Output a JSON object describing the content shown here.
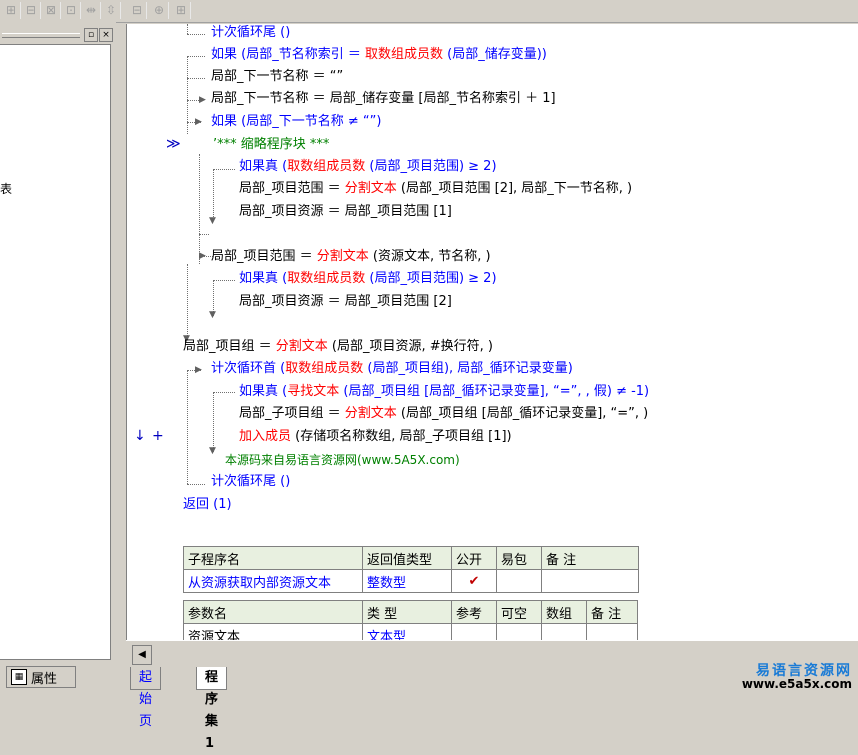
{
  "toolbar": {
    "buttons": [
      "⊞",
      "⊟",
      "⊠",
      "⊡",
      "⇹",
      "⇳",
      "⊟",
      "⊕",
      "⊞"
    ]
  },
  "left_panel": {
    "fragment": "表",
    "pin_symbol": "▫",
    "close_symbol": "×"
  },
  "properties_tab": {
    "label": "属性",
    "icon_glyph": "▦"
  },
  "gutter": {
    "marker": "≫",
    "arrow": "↓",
    "plus": "+"
  },
  "code": {
    "l1": "计次循环尾 ()",
    "l2a": "如果 (局部_节名称索引 ＝ ",
    "l2b": "取数组成员数",
    "l2c": " (局部_储存变量))",
    "l3": "局部_下一节名称 ＝ “”",
    "l4": "局部_下一节名称 ＝ 局部_储存变量 [局部_节名称索引 ＋ 1]",
    "l5": "如果 (局部_下一节名称 ≠ “”)",
    "l6": "’*** 缩略程序块 ***",
    "l7a": "如果真 (",
    "l7b": "取数组成员数",
    "l7c": " (局部_项目范围) ≥ 2)",
    "l8a": "局部_项目范围 ＝ ",
    "l8b": "分割文本",
    "l8c": " (局部_项目范围 [2], 局部_下一节名称, )",
    "l9": "局部_项目资源 ＝ 局部_项目范围 [1]",
    "l10a": "局部_项目范围 ＝ ",
    "l10b": "分割文本",
    "l10c": " (资源文本, 节名称, )",
    "l11a": "如果真 (",
    "l11b": "取数组成员数",
    "l11c": " (局部_项目范围) ≥ 2)",
    "l12": "局部_项目资源 ＝ 局部_项目范围 [2]",
    "l13a": "局部_项目组 ＝ ",
    "l13b": "分割文本",
    "l13c": " (局部_项目资源, #换行符, )",
    "l14a": "计次循环首 (",
    "l14b": "取数组成员数",
    "l14c": " (局部_项目组), 局部_循环记录变量)",
    "l15a": "如果真 (",
    "l15b": "寻找文本",
    "l15c": " (局部_项目组 [局部_循环记录变量], “=”, , 假) ≠ -1)",
    "l16a": "局部_子项目组 ＝ ",
    "l16b": "分割文本",
    "l16c": " (局部_项目组 [局部_循环记录变量], “=”, )",
    "l17a": "加入成员",
    "l17b": " (存储项名称数组, 局部_子项目组 [1])",
    "l18": "本源码来自易语言资源网(www.5A5X.com)",
    "l19": "计次循环尾 ()",
    "l20": "返回 (1)"
  },
  "sub_table": {
    "headers": [
      "子程序名",
      "返回值类型",
      "公开",
      "易包",
      "备 注"
    ],
    "row": {
      "name": "从资源获取内部资源文本",
      "type": "整数型",
      "public": "✔",
      "pkg": "",
      "note": ""
    },
    "param_headers": [
      "参数名",
      "类 型",
      "参考",
      "可空",
      "数组",
      "备 注"
    ],
    "param_row": {
      "name": "资源文本",
      "type": "文本型",
      "ref": "",
      "nullable": "",
      "array": "",
      "note": ""
    }
  },
  "scroll_left": "◀",
  "tabs": [
    {
      "label": "起始页"
    },
    {
      "label": "程序集1"
    }
  ],
  "watermark": {
    "title": "易语言资源网",
    "url": "www.e5a5x.com"
  },
  "colors": {
    "keyword_blue": "#0000ff",
    "function_red": "#ff0000",
    "comment_green": "#008000"
  }
}
